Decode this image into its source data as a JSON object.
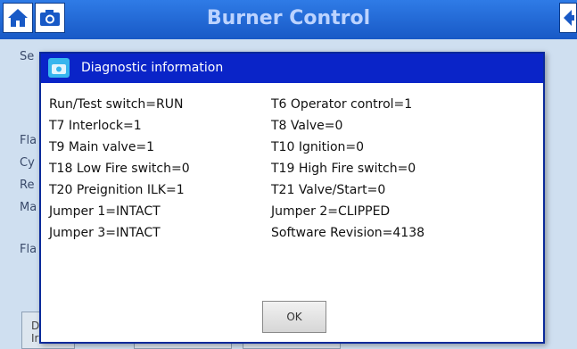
{
  "header": {
    "title": "Burner Control",
    "home_icon": "home-icon",
    "camera_icon": "camera-icon",
    "back_icon": "back-arrow-icon",
    "color": "#1859c6"
  },
  "background": {
    "labels": [
      "Se",
      "Fla",
      "Cy",
      "Re",
      "Ma",
      "Fla"
    ],
    "buttons": [
      "D\nIr"
    ]
  },
  "dialog": {
    "title": "Diagnostic information",
    "left_column": [
      "Run/Test switch=RUN",
      "T7 Interlock=1",
      "T9 Main valve=1",
      "T18 Low Fire switch=0",
      "T20 Preignition ILK=1",
      "Jumper 1=INTACT",
      "Jumper 3=INTACT"
    ],
    "right_column": [
      "T6 Operator control=1",
      "T8 Valve=0",
      "T10 Ignition=0",
      "T19 High Fire switch=0",
      "T21 Valve/Start=0",
      "Jumper 2=CLIPPED",
      "Software Revision=4138"
    ],
    "ok_label": "OK",
    "titlebar_color": "#0a24c8"
  }
}
